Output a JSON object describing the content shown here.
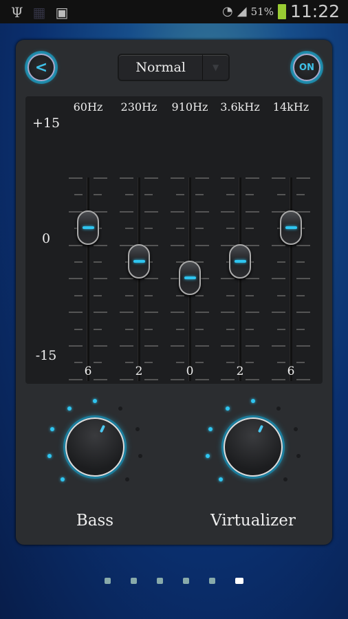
{
  "status_bar": {
    "icons": [
      "usb-icon",
      "debug-icon",
      "sd-card-icon",
      "wifi-icon",
      "signal-icon",
      "battery-charging-icon"
    ],
    "battery": "51%",
    "time": "11:22"
  },
  "header": {
    "back_icon": "chevron-left-icon",
    "preset": "Normal",
    "power_label": "ON"
  },
  "equalizer": {
    "y_max": "+15",
    "y_mid": "0",
    "y_min": "-15",
    "range": [
      -15,
      15
    ],
    "bands": [
      {
        "label": "60Hz",
        "value": 6
      },
      {
        "label": "230Hz",
        "value": 2
      },
      {
        "label": "910Hz",
        "value": 0
      },
      {
        "label": "3.6kHz",
        "value": 2
      },
      {
        "label": "14kHz",
        "value": 6
      }
    ]
  },
  "effects": [
    {
      "label": "Bass",
      "level_dots": 5,
      "total_dots": 9
    },
    {
      "label": "Virtualizer",
      "level_dots": 5,
      "total_dots": 9
    }
  ],
  "accent_color": "#2fc5f0",
  "pager": {
    "pages": 6,
    "current": 6
  }
}
